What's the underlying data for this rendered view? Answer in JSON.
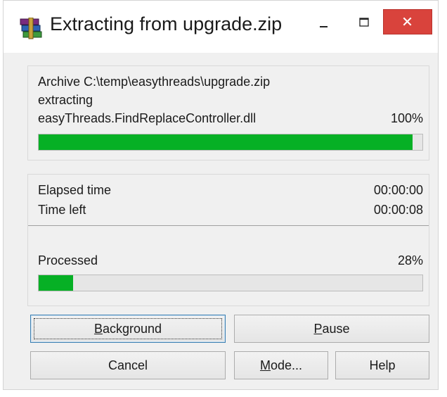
{
  "window": {
    "title": "Extracting from upgrade.zip"
  },
  "archive": {
    "line1": "Archive C:\\temp\\easythreads\\upgrade.zip",
    "line2": "extracting",
    "file_name": "easyThreads.FindReplaceController.dll",
    "file_percent": "100%",
    "file_progress": 0.975
  },
  "stats": {
    "elapsed_label": "Elapsed time",
    "elapsed_value": "00:00:00",
    "timeleft_label": "Time left",
    "timeleft_value": "00:00:08",
    "processed_label": "Processed",
    "processed_percent": "28%",
    "processed_progress": 0.09
  },
  "buttons": {
    "background": {
      "accel": "B",
      "rest": "ackground"
    },
    "pause": {
      "accel": "P",
      "rest": "ause"
    },
    "cancel": "Cancel",
    "mode": {
      "accel": "M",
      "rest": "ode..."
    },
    "help": "Help"
  },
  "colors": {
    "progress_fill": "#06b025",
    "close_button": "#d9433c"
  }
}
